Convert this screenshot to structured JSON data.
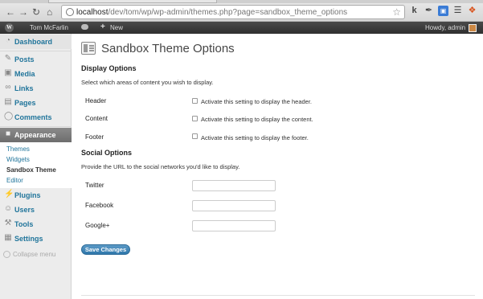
{
  "browser": {
    "url_host": "localhost",
    "url_path": "/dev/tom/wp/wp-admin/themes.php?page=sandbox_theme_options",
    "extensions": [
      "k",
      "pen",
      "screen",
      "layers",
      "bell",
      "fox"
    ]
  },
  "adminbar": {
    "site_name": "Tom McFarlin",
    "new_label": "New",
    "howdy": "Howdy, admin"
  },
  "sidebar": {
    "items": [
      {
        "label": "Dashboard",
        "icon": "dashboard-icon"
      },
      {
        "label": "Posts",
        "icon": "posts-icon"
      },
      {
        "label": "Media",
        "icon": "media-icon"
      },
      {
        "label": "Links",
        "icon": "links-icon"
      },
      {
        "label": "Pages",
        "icon": "pages-icon"
      },
      {
        "label": "Comments",
        "icon": "comments-icon"
      },
      {
        "label": "Appearance",
        "icon": "appearance-icon"
      },
      {
        "label": "Plugins",
        "icon": "plugins-icon"
      },
      {
        "label": "Users",
        "icon": "users-icon"
      },
      {
        "label": "Tools",
        "icon": "tools-icon"
      },
      {
        "label": "Settings",
        "icon": "settings-icon"
      }
    ],
    "submenu": [
      "Themes",
      "Widgets",
      "Sandbox Theme",
      "Editor"
    ],
    "collapse_label": "Collapse menu"
  },
  "page": {
    "title": "Sandbox Theme Options",
    "display_section": {
      "title": "Display Options",
      "description": "Select which areas of content you wish to display.",
      "fields": [
        {
          "label": "Header",
          "checkbox_label": "Activate this setting to display the header.",
          "checked": false
        },
        {
          "label": "Content",
          "checkbox_label": "Activate this setting to display the content.",
          "checked": false
        },
        {
          "label": "Footer",
          "checkbox_label": "Activate this setting to display the footer.",
          "checked": false
        }
      ]
    },
    "social_section": {
      "title": "Social Options",
      "description": "Provide the URL to the social networks you'd like to display.",
      "fields": [
        {
          "label": "Twitter",
          "value": ""
        },
        {
          "label": "Facebook",
          "value": ""
        },
        {
          "label": "Google+",
          "value": ""
        }
      ]
    },
    "save_label": "Save Changes"
  },
  "colors": {
    "link": "#21759b",
    "button": "#2f77ab",
    "active_menu": "#7b7b7b"
  }
}
